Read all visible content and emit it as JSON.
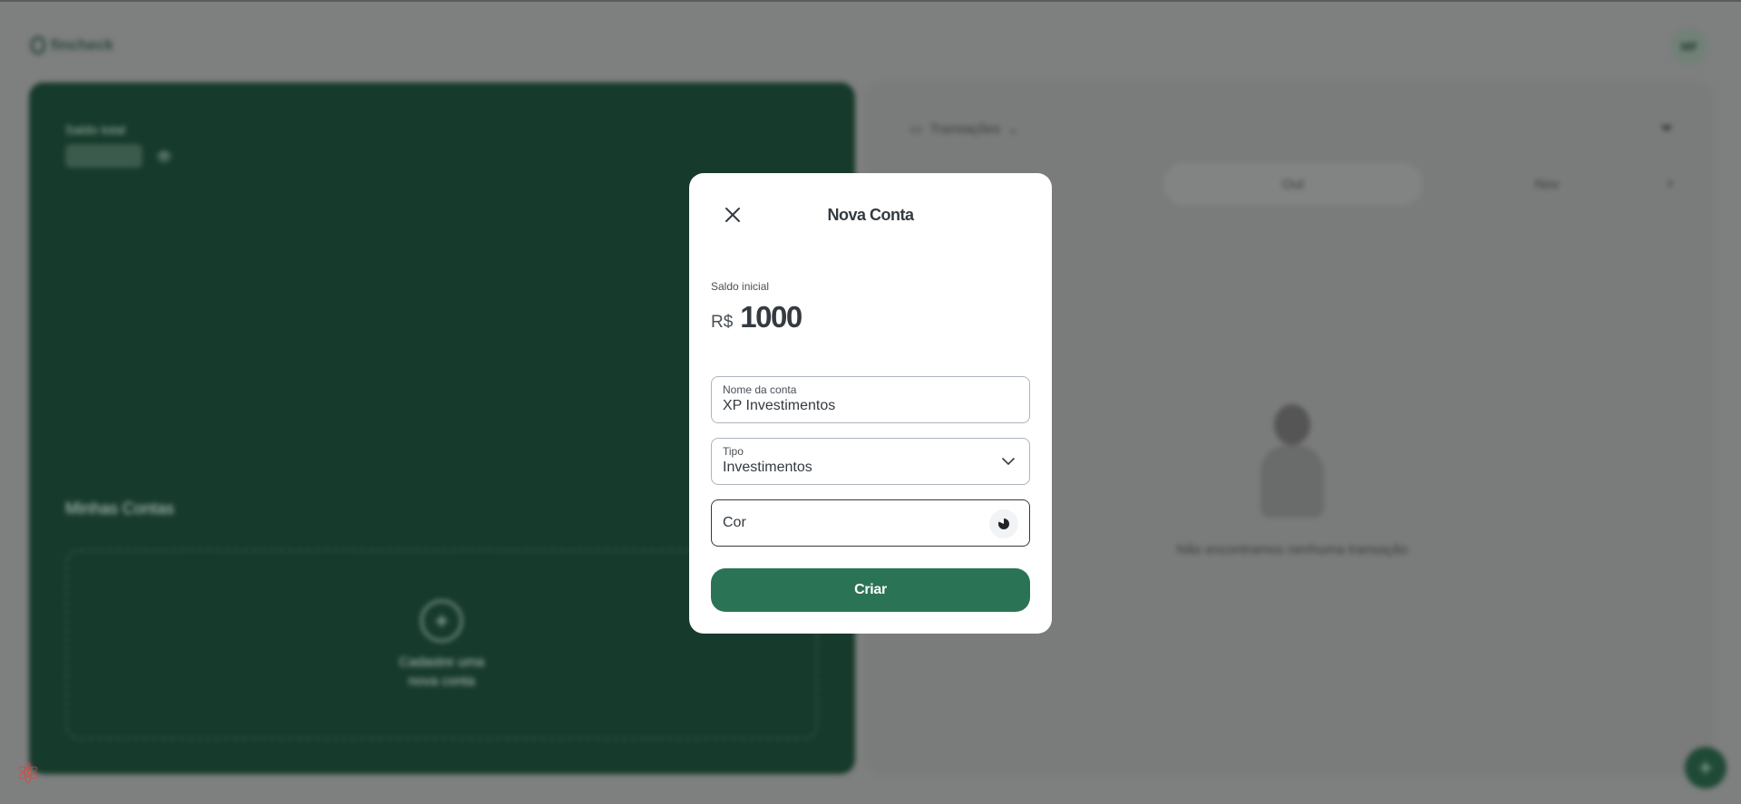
{
  "app": {
    "logo": "fincheck",
    "avatar_initials": "MF"
  },
  "accounts_panel": {
    "total_label": "Saldo total",
    "eye": "👁",
    "my_accounts": "Minhas Contas",
    "add_account_line1": "Cadastre uma",
    "add_account_line2": "nova conta"
  },
  "transactions_panel": {
    "type_label": "Transações",
    "months": [
      "Out",
      "Nov"
    ],
    "empty_text": "Não encontramos nenhuma transação"
  },
  "modal": {
    "title": "Nova Conta",
    "balance_label": "Saldo inicial",
    "currency": "R$",
    "balance_value": "1000",
    "name_field": {
      "label": "Nome da conta",
      "value": "XP Investimentos"
    },
    "type_field": {
      "label": "Tipo",
      "value": "Investimentos"
    },
    "color_field": {
      "label": "Cor"
    },
    "submit_label": "Criar"
  },
  "colors": {
    "accent": "#2b7355",
    "card": "#087f5b",
    "overlay": "#7e7f7f"
  }
}
